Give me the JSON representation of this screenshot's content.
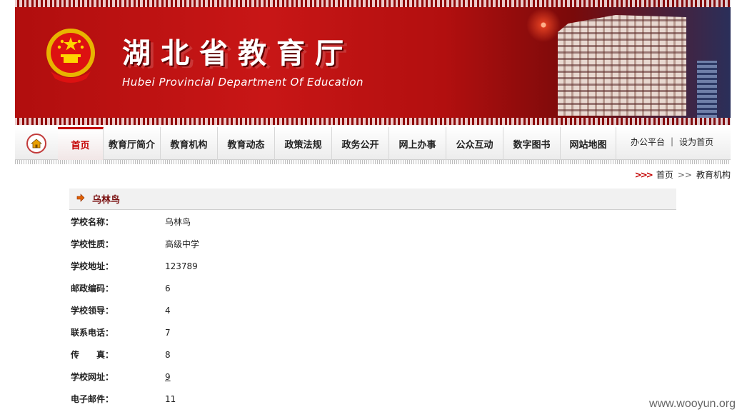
{
  "header": {
    "title_cn": "湖北省教育厅",
    "title_en": "Hubei Provincial Department Of Education"
  },
  "nav": {
    "items": [
      {
        "label": "首页"
      },
      {
        "label": "教育厅简介"
      },
      {
        "label": "教育机构"
      },
      {
        "label": "教育动态"
      },
      {
        "label": "政策法规"
      },
      {
        "label": "政务公开"
      },
      {
        "label": "网上办事"
      },
      {
        "label": "公众互动"
      },
      {
        "label": "数字图书"
      },
      {
        "label": "网站地图"
      }
    ],
    "right_links": [
      {
        "label": "办公平台"
      },
      {
        "label": "设为首页"
      }
    ],
    "separator": "|"
  },
  "breadcrumb": {
    "arrows": ">>>",
    "home": "首页",
    "separator": ">>",
    "current": "教育机构"
  },
  "school": {
    "name_heading": "乌林鸟",
    "fields": [
      {
        "label": "学校名称：",
        "value": "乌林鸟"
      },
      {
        "label": "学校性质：",
        "value": "高级中学"
      },
      {
        "label": "学校地址：",
        "value": "123789"
      },
      {
        "label": "邮政编码：",
        "value": "6"
      },
      {
        "label": "学校领导：",
        "value": "4"
      },
      {
        "label": "联系电话：",
        "value": "7"
      },
      {
        "label": "传　　真：",
        "value": "8"
      },
      {
        "label": "学校网址：",
        "value": "9"
      },
      {
        "label": "电子邮件：",
        "value": "11"
      }
    ]
  },
  "watermark": "www.wooyun.org",
  "colors": {
    "brand_red": "#c40000",
    "banner_red": "#b10e0e",
    "heading_dark_red": "#7a1010"
  }
}
